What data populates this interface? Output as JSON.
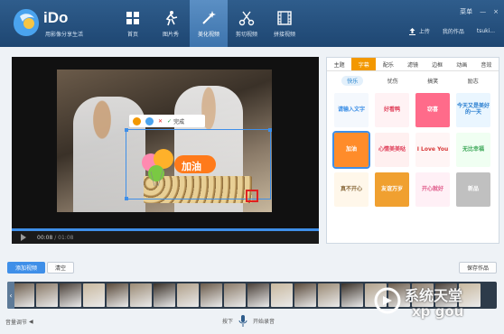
{
  "app": {
    "brand": "iDo",
    "slogan": "用影像分享生活"
  },
  "nav": [
    {
      "label": "首页",
      "icon": "grid-icon"
    },
    {
      "label": "图片秀",
      "icon": "person-icon"
    },
    {
      "label": "美化视频",
      "icon": "magic-wand-icon",
      "active": true
    },
    {
      "label": "剪切视频",
      "icon": "scissors-icon"
    },
    {
      "label": "拼接视频",
      "icon": "film-icon"
    }
  ],
  "window": {
    "menu_label": "菜单",
    "minimize": "—",
    "close": "×"
  },
  "account": {
    "upload_label": "上传",
    "my_works_label": "我的作品",
    "username": "tsuki..."
  },
  "sticker_toolbar": {
    "done_label": "完成"
  },
  "sticker_text": "加油",
  "player": {
    "time_current": "00:08",
    "time_separator": "/",
    "time_total": "01:08"
  },
  "panel": {
    "tabs": [
      {
        "label": "主题"
      },
      {
        "label": "字幕",
        "active": true
      },
      {
        "label": "配乐"
      },
      {
        "label": "滤镜"
      },
      {
        "label": "边框"
      },
      {
        "label": "动画"
      },
      {
        "label": "音效"
      }
    ],
    "subtabs": [
      {
        "label": "快乐",
        "active": true
      },
      {
        "label": "忧伤"
      },
      {
        "label": "搞笑"
      },
      {
        "label": "励志"
      }
    ],
    "stickers": [
      {
        "text": "请输入文字",
        "color": "#3a8ee6",
        "bg": "#f4f8fd"
      },
      {
        "text": "好看鸭",
        "color": "#e0405a",
        "bg": "#fff2f4"
      },
      {
        "text": "窃喜",
        "color": "#ffffff",
        "bg": "#ff6b8a"
      },
      {
        "text": "今天又是美好的一天",
        "color": "#2b7fd0",
        "bg": "#eaf6ff"
      },
      {
        "text": "加油",
        "color": "#ffffff",
        "bg": "#ff8c2a",
        "selected": true
      },
      {
        "text": "心情美美哒",
        "color": "#e0405a",
        "bg": "#fff0f0"
      },
      {
        "text": "I Love You",
        "color": "#d83a3a",
        "bg": "#fff5f5"
      },
      {
        "text": "无比幸福",
        "color": "#3aa655",
        "bg": "#f0fff2"
      },
      {
        "text": "真不开心",
        "color": "#8a6a3c",
        "bg": "#fff7ea"
      },
      {
        "text": "友谊万岁",
        "color": "#ffffff",
        "bg": "#f0a030"
      },
      {
        "text": "开心就好",
        "color": "#e05a8a",
        "bg": "#fff0f6"
      },
      {
        "text": "新品",
        "color": "#ffffff",
        "bg": "#c0c0c0"
      }
    ]
  },
  "buttons": {
    "add_video": "添加视频",
    "clear": "清空",
    "save_work": "保存作品"
  },
  "footer": {
    "volume_label": "音量调节",
    "press_label": "按下",
    "record_label": "开始录音"
  },
  "watermark": {
    "line1": "系统天堂",
    "line2": "xp gou"
  },
  "colors": {
    "accent": "#3f8fe8",
    "tab_active": "#f39800",
    "header": "#2f5d8c"
  }
}
